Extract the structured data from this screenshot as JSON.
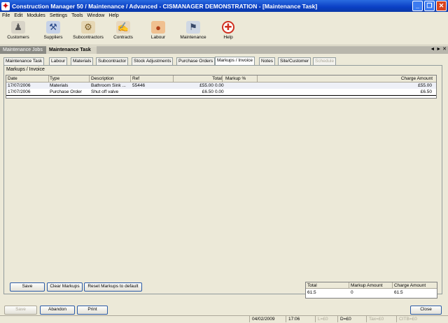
{
  "window": {
    "title": "Construction Manager 50 / Maintenance / Advanced  - CISMANAGER  DEMONSTRATION - [Maintenance Task]",
    "minimize": "_",
    "restore": "❐",
    "close": "✕"
  },
  "menu": [
    "File",
    "Edit",
    "Modules",
    "Settings",
    "Tools",
    "Window",
    "Help"
  ],
  "toolbar": [
    {
      "label": "Customers",
      "icon": "customers-icon"
    },
    {
      "label": "Suppliers",
      "icon": "suppliers-icon"
    },
    {
      "label": "Subcontractors",
      "icon": "subcontractors-icon"
    },
    {
      "label": "Contracts",
      "icon": "contracts-icon"
    },
    {
      "label": "Labour",
      "icon": "labour-icon"
    },
    {
      "label": "Maintenance",
      "icon": "maintenance-icon"
    },
    {
      "label": "Help",
      "icon": "help-icon"
    }
  ],
  "doc_tabs": [
    "Maintenance Jobs",
    "Maintenance Task"
  ],
  "doc_tabs_nav": "◄ ► ✕",
  "task_tabs": [
    "Maintenance Task",
    "Labour",
    "Materials",
    "Subcontractor",
    "Stock Adjustments",
    "Purchase Orders",
    "Markups / Invoice",
    "Notes",
    "Site/Customer",
    "Schedule"
  ],
  "group_label": "Markups / Invoice",
  "grid": {
    "headers": [
      "Date",
      "Type",
      "Description",
      "Ref",
      "Total",
      "Markup %",
      "Charge Amount"
    ],
    "rows": [
      [
        "17/07/2006",
        "Materials",
        "Bathroom Sink ...",
        "55446",
        "£55.00",
        "0.00",
        "£55.00"
      ],
      [
        "17/07/2006",
        "Purchase Order",
        "Shut off valve",
        "",
        "£6.50",
        "0.00",
        "£6.50"
      ]
    ]
  },
  "buttons": {
    "save": "Save",
    "clear_markups": "Clear Markups",
    "reset_markups": "Reset Markups to default"
  },
  "totals": {
    "headers": [
      "Total",
      "Markup Amount",
      "Charge Amount"
    ],
    "values": [
      "61.5",
      "0",
      "61.5"
    ]
  },
  "bottom": {
    "save": "Save",
    "abandon": "Abandon",
    "print": "Print",
    "close": "Close"
  },
  "status": {
    "date": "04/02/2009",
    "time": "17:06",
    "l": "L=£0",
    "d": "D=£0",
    "tax": "Tax=£0",
    "citb": "CITB=£0"
  }
}
